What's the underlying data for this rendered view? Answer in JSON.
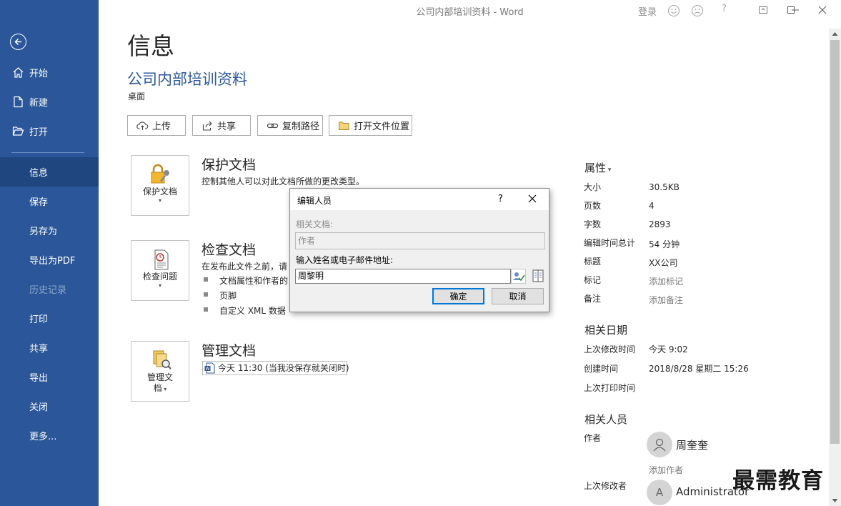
{
  "window": {
    "title": "公司内部培训资料  -  Word",
    "login": "登录",
    "help": "?"
  },
  "sidebar": {
    "items": [
      {
        "label": "开始"
      },
      {
        "label": "新建"
      },
      {
        "label": "打开"
      },
      {
        "label": "信息"
      },
      {
        "label": "保存"
      },
      {
        "label": "另存为"
      },
      {
        "label": "导出为PDF"
      },
      {
        "label": "历史记录"
      },
      {
        "label": "打印"
      },
      {
        "label": "共享"
      },
      {
        "label": "导出"
      },
      {
        "label": "关闭"
      },
      {
        "label": "更多..."
      }
    ]
  },
  "main": {
    "page_title": "信息",
    "doc_title": "公司内部培训资料",
    "doc_location": "桌面",
    "actions": {
      "upload": "上传",
      "share": "共享",
      "copy_path": "复制路径",
      "open_location": "打开文件位置"
    },
    "protect": {
      "tile_label": "保护文档",
      "title": "保护文档",
      "desc": "控制其他人可以对此文档所做的更改类型。"
    },
    "inspect": {
      "tile_label": "检查问题",
      "title": "检查文档",
      "desc": "在发布此文件之前，请",
      "bullets": [
        "文档属性和作者的",
        "页脚",
        "自定义 XML 数据"
      ]
    },
    "manage": {
      "tile_label_1": "管理文",
      "tile_label_2": "档",
      "title": "管理文档",
      "version": "今天 11:30 (当我没保存就关闭时)"
    }
  },
  "properties": {
    "header": "属性",
    "rows": [
      {
        "key": "大小",
        "value": "30.5KB"
      },
      {
        "key": "页数",
        "value": "4"
      },
      {
        "key": "字数",
        "value": "2893"
      },
      {
        "key": "编辑时间总计",
        "value": "54 分钟"
      },
      {
        "key": "标题",
        "value": "XX公司"
      },
      {
        "key": "标记",
        "value": "添加标记"
      },
      {
        "key": "备注",
        "value": "添加备注"
      }
    ],
    "dates_header": "相关日期",
    "dates": [
      {
        "key": "上次修改时间",
        "value": "今天 9:02"
      },
      {
        "key": "创建时间",
        "value": "2018/8/28 星期二 15:26"
      },
      {
        "key": "上次打印时间",
        "value": ""
      }
    ],
    "people_header": "相关人员",
    "author_key": "作者",
    "author_name": "周奎奎",
    "add_author": "添加作者",
    "modifier_key": "上次修改者",
    "modifier_initial": "A",
    "modifier_name": "Administrator"
  },
  "dialog": {
    "title": "编辑人员",
    "help": "?",
    "related_label": "相关文档:",
    "related_value": "作者",
    "input_label": "输入姓名或电子邮件地址:",
    "input_value": "周黎明",
    "ok": "确定",
    "cancel": "取消"
  },
  "watermark": "最需教育"
}
